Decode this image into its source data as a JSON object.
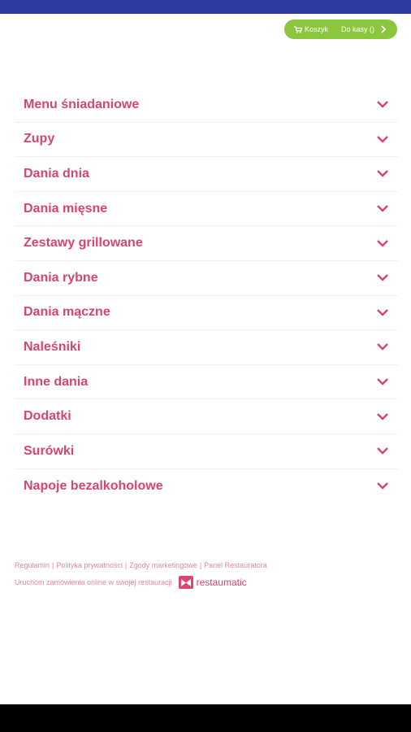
{
  "colors": {
    "topbar": "#2f3aa3",
    "accent": "#d6456e",
    "cart_green": "#8cc63f"
  },
  "cart": {
    "cart_label": "Koszyk",
    "checkout_label": "Do kasy ()",
    "cart_icon": "cart-icon",
    "arrow_icon": "chevron-right-icon"
  },
  "menu": {
    "items": [
      {
        "label": "Menu śniadaniowe"
      },
      {
        "label": "Zupy"
      },
      {
        "label": "Dania dnia"
      },
      {
        "label": "Dania mięsne"
      },
      {
        "label": "Zestawy grillowane"
      },
      {
        "label": "Dania rybne"
      },
      {
        "label": "Dania mączne"
      },
      {
        "label": "Naleśniki"
      },
      {
        "label": "Inne dania"
      },
      {
        "label": "Dodatki"
      },
      {
        "label": "Surówki"
      },
      {
        "label": "Napoje bezalkoholowe"
      }
    ],
    "expand_icon": "chevron-down-icon"
  },
  "footer": {
    "links": [
      "Regulamin",
      "Polityka prywatności",
      "Zgody marketingowe",
      "Panel Restauratora"
    ],
    "separator": "|",
    "promo_text": "Uruchom zamówienia online w swojej restauracji",
    "brand": "restaumatic"
  }
}
